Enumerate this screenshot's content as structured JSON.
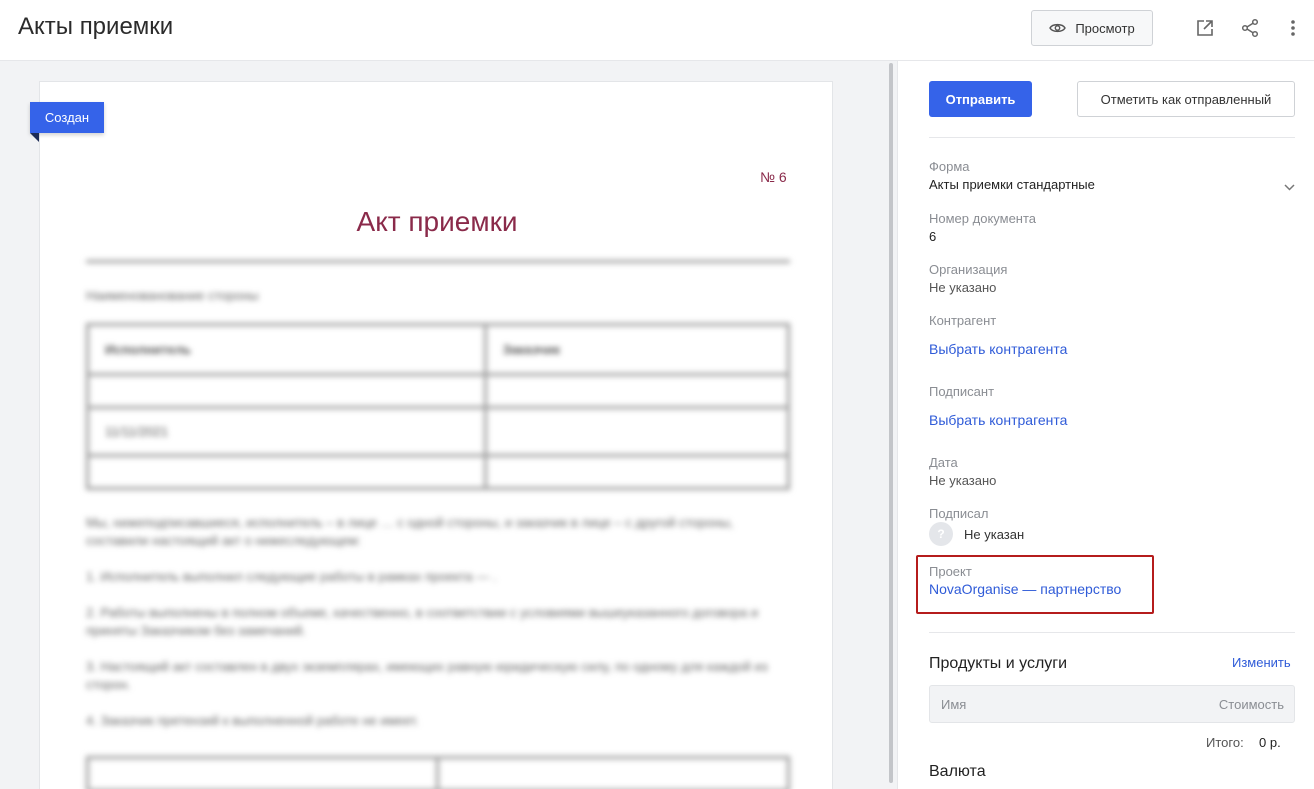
{
  "header": {
    "title": "Акты приемки",
    "preview_label": "Просмотр"
  },
  "document": {
    "status": "Создан",
    "number": "№ 6",
    "heading": "Акт приемки",
    "blurred": {
      "parties_label": "Наименованование стороны",
      "table_headers": [
        "Исполнитель",
        "Заказчик"
      ],
      "table_date": "11/11/2021",
      "paragraphs": [
        "Мы, нижеподписавшиеся, исполнитель – в лице … с одной стороны, и заказчик в лице – с другой стороны, составили настоящий акт о нижеследующем:",
        "1. Исполнитель выполнил следующие работы в рамках проекта — .",
        "2. Работы выполнены в полном объеме, качественно, в соответствии с условиями вышеуказанного договора и приняты Заказчиком без замечаний.",
        "3. Настоящий акт составлен в двух экземплярах, имеющих равную юридическую силу, по одному для каждой из сторон.",
        "4. Заказчик претензий к выполненной работе не имеет."
      ]
    }
  },
  "panel": {
    "send_label": "Отправить",
    "mark_sent_label": "Отметить как отправленный",
    "form": {
      "label": "Форма",
      "value": "Акты приемки стандартные"
    },
    "doc_number": {
      "label": "Номер документа",
      "value": "6"
    },
    "organization": {
      "label": "Организация",
      "value": "Не указано"
    },
    "counterparty": {
      "label": "Контрагент",
      "link": "Выбрать контрагента"
    },
    "signer": {
      "label": "Подписант",
      "link": "Выбрать контрагента"
    },
    "date": {
      "label": "Дата",
      "value": "Не указано"
    },
    "signed_by": {
      "label": "Подписал",
      "avatar": "?",
      "value": "Не указан"
    },
    "project": {
      "label": "Проект",
      "link": "NovaOrganise — партнерство"
    },
    "products": {
      "title": "Продукты и услуги",
      "edit_label": "Изменить",
      "col_name": "Имя",
      "col_cost": "Стоимость",
      "total_label": "Итого:",
      "total_value": "0 р."
    },
    "currency_title": "Валюта"
  },
  "colors": {
    "accent": "#3563e9",
    "link": "#2f5bd8",
    "doc_title": "#8a2a4a",
    "highlight": "#b51c1c"
  }
}
